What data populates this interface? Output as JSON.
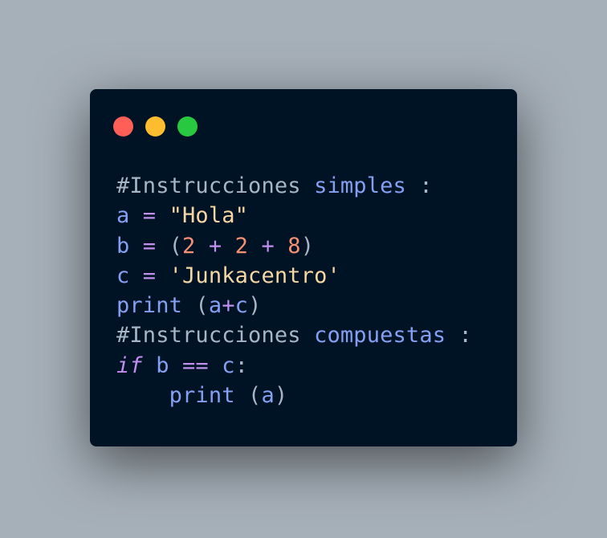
{
  "window": {
    "controls": [
      {
        "name": "close",
        "color": "#ff5f57"
      },
      {
        "name": "minimize",
        "color": "#febc2e"
      },
      {
        "name": "maximize",
        "color": "#28c840"
      }
    ]
  },
  "code": {
    "lines": [
      [
        {
          "t": "#Instrucciones ",
          "k": "comment"
        },
        {
          "t": "simples",
          "k": "name"
        },
        {
          "t": " :",
          "k": "comment"
        }
      ],
      [
        {
          "t": "a",
          "k": "name"
        },
        {
          "t": " = ",
          "k": "op"
        },
        {
          "t": "\"Hola\"",
          "k": "string"
        }
      ],
      [
        {
          "t": "b",
          "k": "name"
        },
        {
          "t": " = ",
          "k": "op"
        },
        {
          "t": "(",
          "k": "punct"
        },
        {
          "t": "2",
          "k": "number"
        },
        {
          "t": " + ",
          "k": "op"
        },
        {
          "t": "2",
          "k": "number"
        },
        {
          "t": " + ",
          "k": "op"
        },
        {
          "t": "8",
          "k": "number"
        },
        {
          "t": ")",
          "k": "punct"
        }
      ],
      [
        {
          "t": "c",
          "k": "name"
        },
        {
          "t": " = ",
          "k": "op"
        },
        {
          "t": "'Junkacentro'",
          "k": "string"
        }
      ],
      [
        {
          "t": "print",
          "k": "name"
        },
        {
          "t": " (",
          "k": "punct"
        },
        {
          "t": "a",
          "k": "name"
        },
        {
          "t": "+",
          "k": "op"
        },
        {
          "t": "c",
          "k": "name"
        },
        {
          "t": ")",
          "k": "punct"
        }
      ],
      [
        {
          "t": "#Instrucciones ",
          "k": "comment"
        },
        {
          "t": "compuestas",
          "k": "name"
        },
        {
          "t": " :",
          "k": "comment"
        }
      ],
      [
        {
          "t": "if",
          "k": "keyword"
        },
        {
          "t": " ",
          "k": "punct"
        },
        {
          "t": "b",
          "k": "name"
        },
        {
          "t": " == ",
          "k": "op"
        },
        {
          "t": "c",
          "k": "name"
        },
        {
          "t": ":",
          "k": "punct"
        }
      ],
      [
        {
          "t": "    ",
          "k": "punct"
        },
        {
          "t": "print",
          "k": "name"
        },
        {
          "t": " (",
          "k": "punct"
        },
        {
          "t": "a",
          "k": "name"
        },
        {
          "t": ")",
          "k": "punct"
        }
      ]
    ]
  }
}
